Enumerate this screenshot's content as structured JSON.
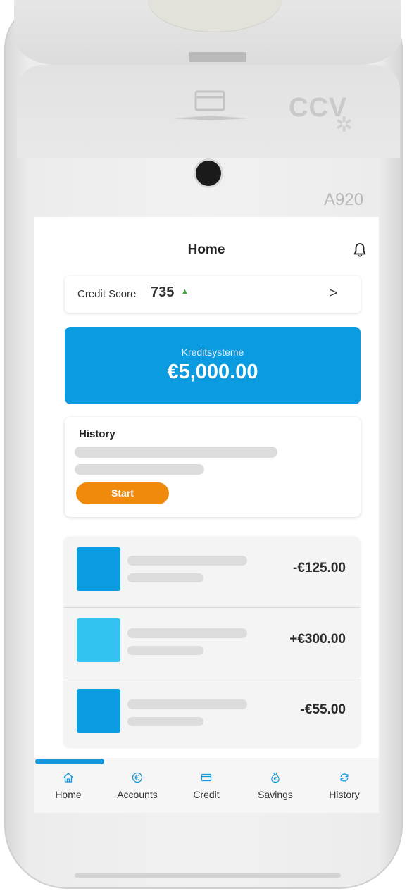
{
  "device": {
    "brand": "CCV",
    "model": "A920"
  },
  "header": {
    "title": "Home"
  },
  "credit_score": {
    "label": "Credit Score",
    "value": "735",
    "trend": "up",
    "chevron": ">"
  },
  "balance": {
    "label": "Kreditsysteme",
    "amount": "€5,000.00"
  },
  "history": {
    "title": "History",
    "start_label": "Start"
  },
  "transactions": [
    {
      "amount": "-€125.00",
      "icon_color": "#0a9be0"
    },
    {
      "amount": "+€300.00",
      "icon_color": "#34c2f0"
    },
    {
      "amount": "-€55.00",
      "icon_color": "#0a9be0"
    }
  ],
  "nav": {
    "active": "Home",
    "items": [
      {
        "label": "Home",
        "icon": "home-icon"
      },
      {
        "label": "Accounts",
        "icon": "euro-coin-icon"
      },
      {
        "label": "Credit",
        "icon": "credit-card-icon"
      },
      {
        "label": "Savings",
        "icon": "money-bag-icon"
      },
      {
        "label": "History",
        "icon": "refresh-icon"
      }
    ]
  },
  "colors": {
    "primary_blue": "#0a9be0",
    "light_blue": "#34c2f0",
    "accent_orange": "#f08a0c",
    "trend_green": "#3fa535"
  }
}
